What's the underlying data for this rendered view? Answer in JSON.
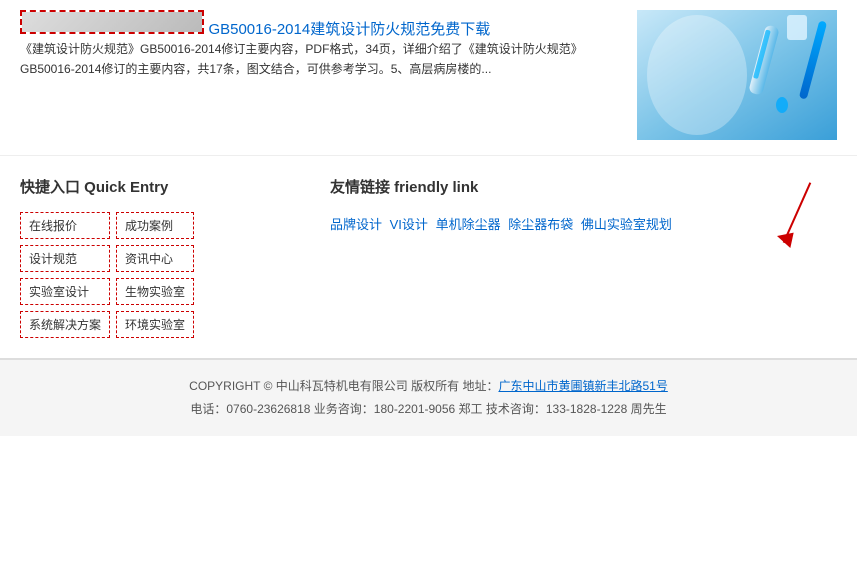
{
  "article": {
    "title": "GB50016-2014建筑设计防火规范免费下载",
    "description": "《建筑设计防火规范》GB50016-2014修订主要内容，PDF格式，34页，详细介绍了《建筑设计防火规范》GB50016-2014修订的主要内容，共17条，图文结合，可供参考学习。5、高层病房楼的..."
  },
  "quick_entry": {
    "title": "快捷入口 Quick Entry",
    "links": [
      "在线报价",
      "成功案例",
      "设计规范",
      "资讯中心",
      "实验室设计",
      "生物实验室",
      "系统解决方案",
      "环境实验室"
    ]
  },
  "friendly_links": {
    "title": "友情链接 friendly link",
    "links": [
      "品牌设计",
      "VI设计",
      "单机除尘器",
      "除尘器布袋",
      "佛山实验室规划"
    ]
  },
  "footer": {
    "copyright_label": "COPYRIGHT",
    "copyright_text": "COPYRIGHT © 中山科瓦特机电有限公司 版权所有 地址：",
    "address_link": "广东中山市黄圃镇新丰北路51号",
    "phone_line": "电话：0760-23626818 业务咨询：180-2201-9056 郑工 技术咨询：133-1828-1228 周先生"
  }
}
